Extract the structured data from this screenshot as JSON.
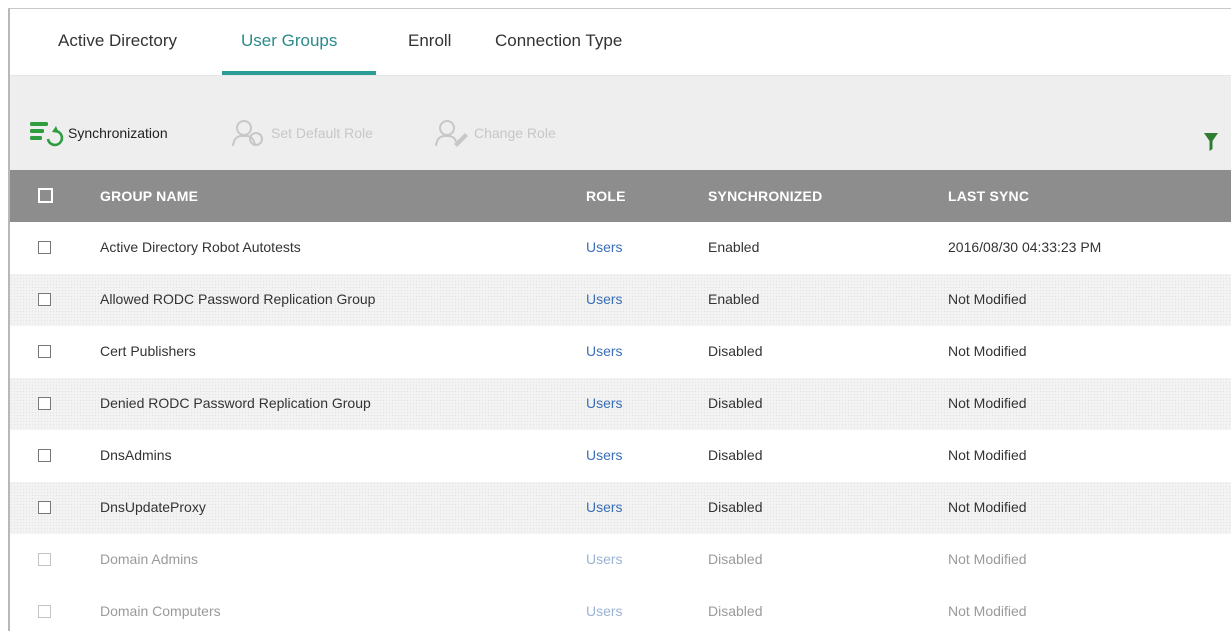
{
  "tabs": [
    {
      "label": "Active Directory",
      "active": false
    },
    {
      "label": "User Groups",
      "active": true
    },
    {
      "label": "Enroll",
      "active": false
    },
    {
      "label": "Connection Type",
      "active": false
    }
  ],
  "toolbar": {
    "sync_label": "Synchronization",
    "set_default_role_label": "Set Default Role",
    "change_role_label": "Change Role",
    "filter_icon": "filter-icon"
  },
  "table": {
    "headers": {
      "group_name": "GROUP NAME",
      "role": "ROLE",
      "synchronized": "SYNCHRONIZED",
      "last_sync": "LAST SYNC"
    },
    "rows": [
      {
        "group_name": "Active Directory Robot Autotests",
        "role": "Users",
        "synchronized": "Enabled",
        "last_sync": "2016/08/30 04:33:23 PM"
      },
      {
        "group_name": "Allowed RODC Password Replication Group",
        "role": "Users",
        "synchronized": "Enabled",
        "last_sync": "Not Modified"
      },
      {
        "group_name": "Cert Publishers",
        "role": "Users",
        "synchronized": "Disabled",
        "last_sync": "Not Modified"
      },
      {
        "group_name": "Denied RODC Password Replication Group",
        "role": "Users",
        "synchronized": "Disabled",
        "last_sync": "Not Modified"
      },
      {
        "group_name": "DnsAdmins",
        "role": "Users",
        "synchronized": "Disabled",
        "last_sync": "Not Modified"
      },
      {
        "group_name": "DnsUpdateProxy",
        "role": "Users",
        "synchronized": "Disabled",
        "last_sync": "Not Modified"
      },
      {
        "group_name": "Domain Admins",
        "role": "Users",
        "synchronized": "Disabled",
        "last_sync": "Not Modified"
      },
      {
        "group_name": "Domain Computers",
        "role": "Users",
        "synchronized": "Disabled",
        "last_sync": "Not Modified"
      }
    ]
  },
  "colors": {
    "accent": "#2b9c96",
    "header_bg": "#8d8d8d",
    "toolbar_bg": "#eeeeee",
    "role_link": "#3a6fb5",
    "sync_icon_green": "#2e9c3f",
    "filter_green": "#2e7d32"
  }
}
